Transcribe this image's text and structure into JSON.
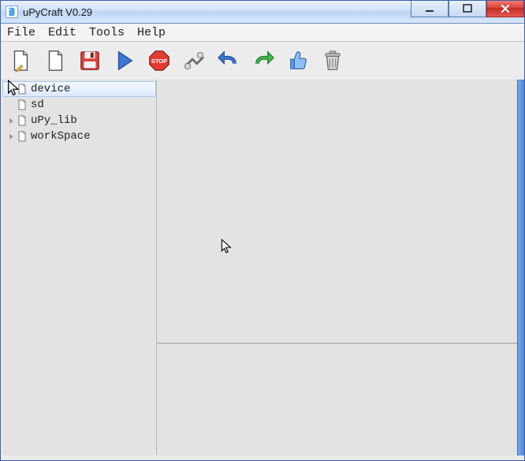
{
  "window": {
    "title": "uPyCraft V0.29"
  },
  "menubar": {
    "file": "File",
    "edit": "Edit",
    "tools": "Tools",
    "help": "Help"
  },
  "toolbar_icons": {
    "new": "new-file-icon",
    "open": "open-file-icon",
    "save": "save-icon",
    "run": "run-icon",
    "stop": "stop-icon",
    "connect": "connect-icon",
    "undo": "undo-icon",
    "redo": "redo-icon",
    "sync": "thumbs-up-icon",
    "clear": "trash-icon"
  },
  "tree": {
    "items": [
      {
        "label": "device",
        "expandable": false,
        "selected": true
      },
      {
        "label": "sd",
        "expandable": false,
        "selected": false
      },
      {
        "label": "uPy_lib",
        "expandable": true,
        "selected": false
      },
      {
        "label": "workSpace",
        "expandable": true,
        "selected": false
      }
    ]
  }
}
